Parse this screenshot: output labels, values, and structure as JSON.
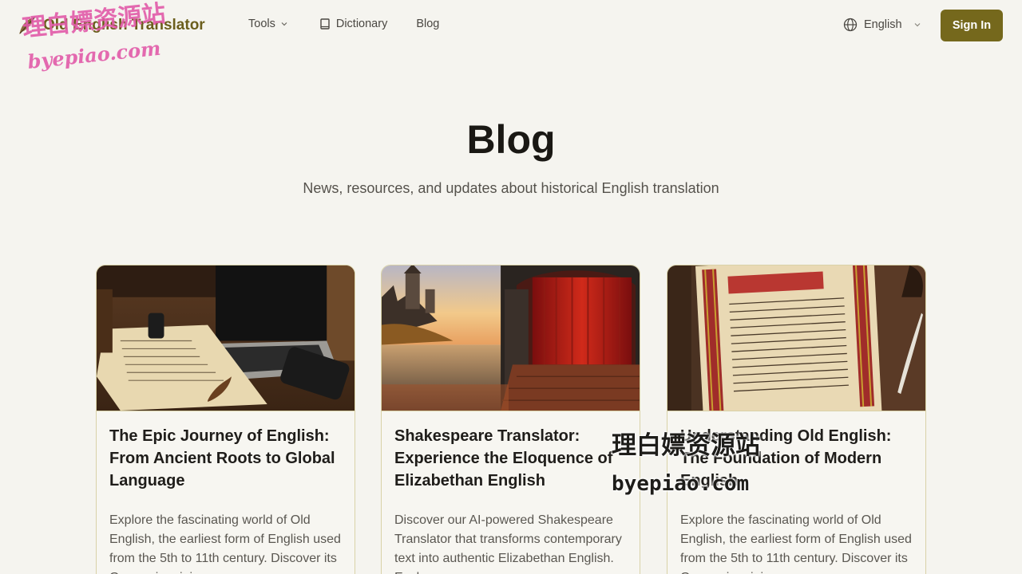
{
  "header": {
    "logo_text": "Old English Translator",
    "nav": {
      "tools": "Tools",
      "dictionary": "Dictionary",
      "blog": "Blog"
    },
    "language": "English",
    "sign_in": "Sign In"
  },
  "hero": {
    "title": "Blog",
    "subtitle": "News, resources, and updates about historical English translation"
  },
  "posts": [
    {
      "title": "The Epic Journey of English: From Ancient Roots to Global Language",
      "excerpt": "Explore the fascinating world of Old English, the earliest form of English used from the 5th to 11th century. Discover its Germanic origins,"
    },
    {
      "title": "Shakespeare Translator: Experience the Eloquence of Elizabethan English",
      "excerpt": "Discover our AI-powered Shakespeare Translator that transforms contemporary text into authentic Elizabethan English. Explore"
    },
    {
      "title": "Understanding Old English: The Foundation of Modern English",
      "excerpt": "Explore the fascinating world of Old English, the earliest form of English used from the 5th to 11th century. Discover its Germanic origins,"
    }
  ],
  "watermark": {
    "line1": "理白嫖资源站",
    "line2": "byepiao.com"
  },
  "colors": {
    "brand": "#75681c",
    "background": "#f5f4ef",
    "card_border": "#d9d2a8"
  }
}
